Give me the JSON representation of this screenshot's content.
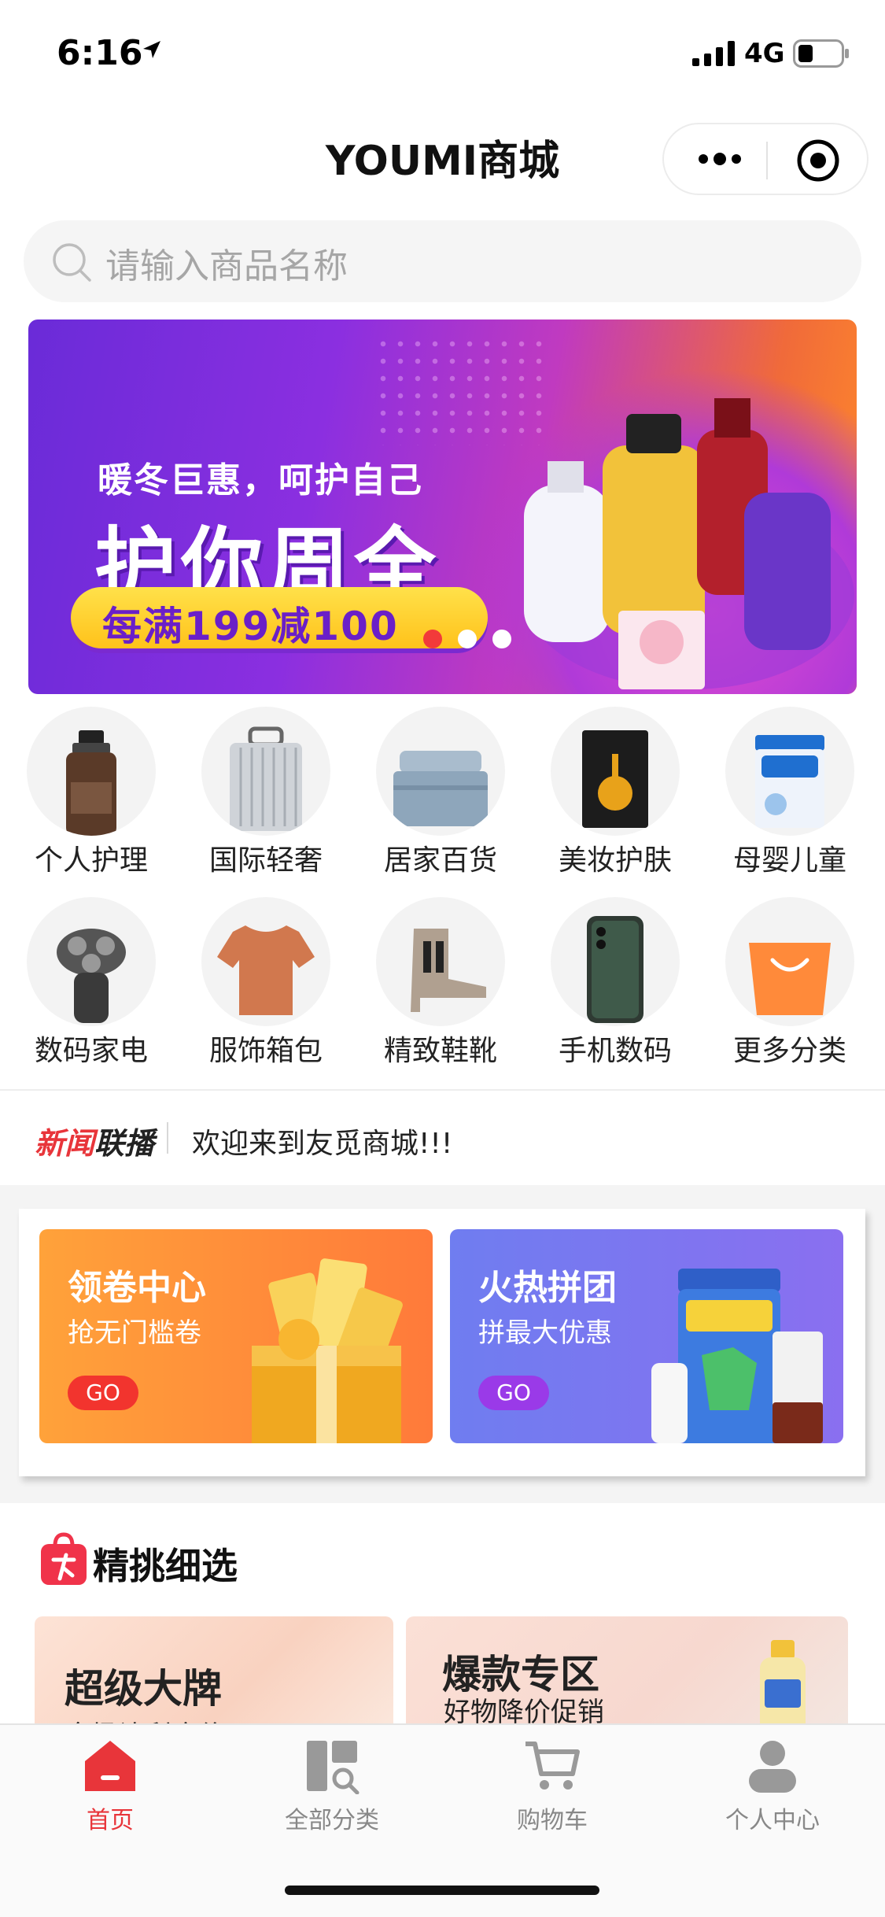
{
  "status_bar": {
    "time": "6:16",
    "network": "4G"
  },
  "nav": {
    "title": "YOUMI商城"
  },
  "search": {
    "placeholder": "请输入商品名称"
  },
  "banner": {
    "subtitle": "暖冬巨惠，呵护自己",
    "headline": "护你周全",
    "offer": "每满199减100",
    "slide_count": 3,
    "active_slide": 1
  },
  "categories": [
    {
      "label": "个人护理",
      "icon": "shampoo-bottle-icon"
    },
    {
      "label": "国际轻奢",
      "icon": "suitcase-icon"
    },
    {
      "label": "居家百货",
      "icon": "bedding-icon"
    },
    {
      "label": "美妆护肤",
      "icon": "honey-mask-icon"
    },
    {
      "label": "母婴儿童",
      "icon": "formula-can-icon"
    },
    {
      "label": "数码家电",
      "icon": "shaver-icon"
    },
    {
      "label": "服饰箱包",
      "icon": "tshirt-icon"
    },
    {
      "label": "精致鞋靴",
      "icon": "boot-icon"
    },
    {
      "label": "手机数码",
      "icon": "smartphone-icon"
    },
    {
      "label": "更多分类",
      "icon": "shopping-bag-icon"
    }
  ],
  "news": {
    "logo_part1": "新闻",
    "logo_part2": "联播",
    "text": "欢迎来到友觅商城!!!"
  },
  "promos": {
    "coupon": {
      "title": "领卷中心",
      "subtitle": "抢无门槛卷",
      "button": "GO"
    },
    "group": {
      "title": "火热拼团",
      "subtitle": "拼最大优惠",
      "button": "GO"
    }
  },
  "featured": {
    "title": "精挑细选",
    "cards": {
      "brand": {
        "title": "超级大牌",
        "subtitle": "全场让利底价"
      },
      "hot": {
        "title": "爆款专区",
        "subtitle": "好物降价促销"
      }
    }
  },
  "tab_bar": {
    "items": [
      {
        "label": "首页",
        "active": true
      },
      {
        "label": "全部分类",
        "active": false
      },
      {
        "label": "购物车",
        "active": false
      },
      {
        "label": "个人中心",
        "active": false
      }
    ]
  },
  "colors": {
    "accent": "#e8353a",
    "inactive_tab": "#888888",
    "banner_pill": "#ffc21a"
  }
}
